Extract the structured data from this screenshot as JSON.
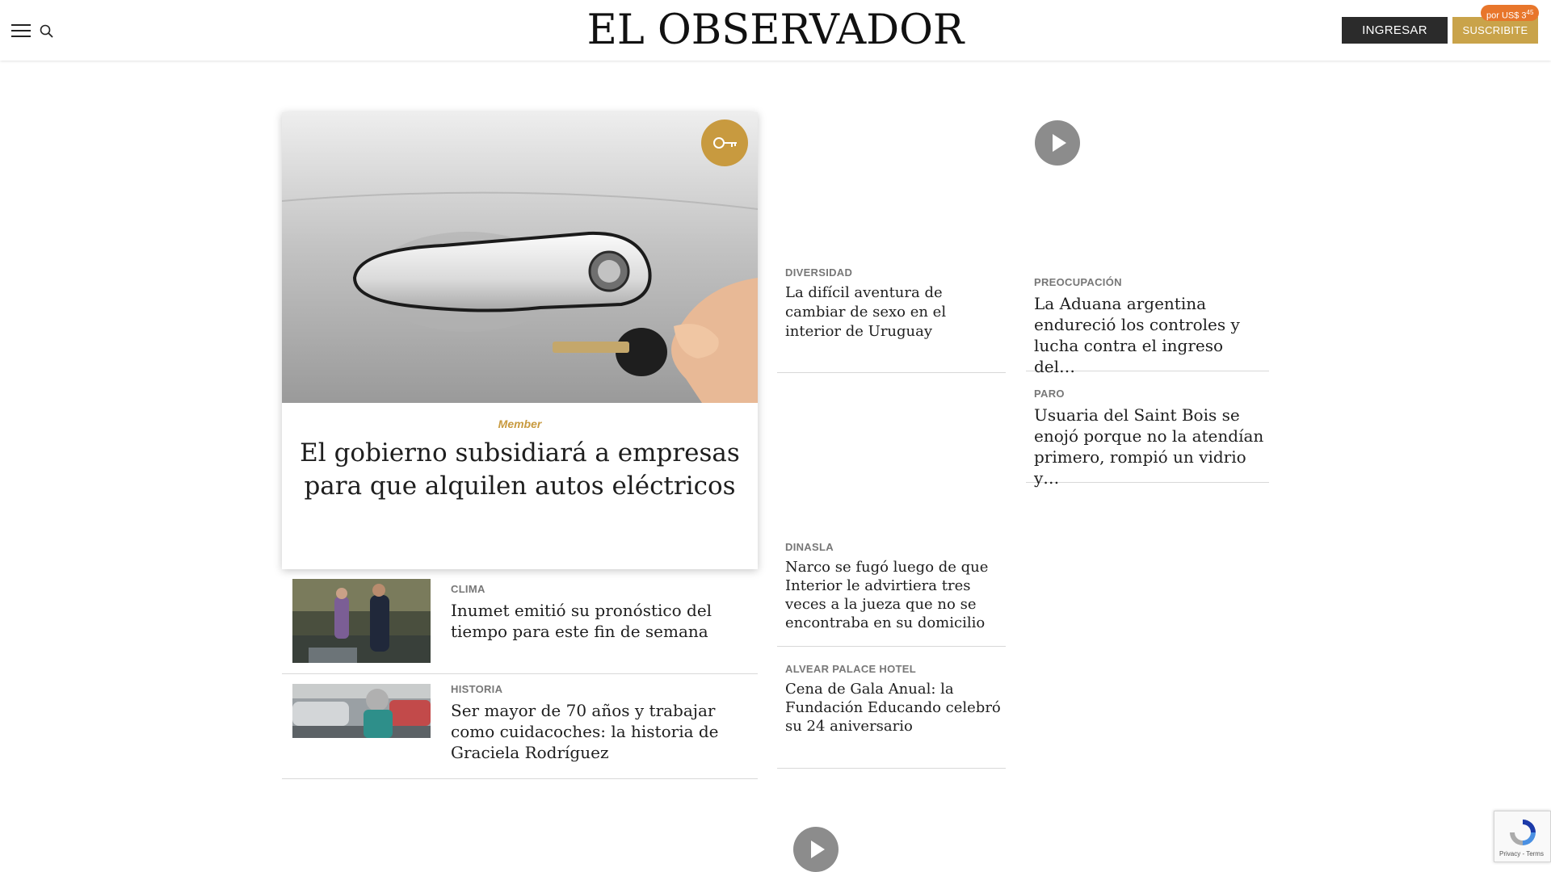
{
  "header": {
    "logo": "EL OBSERVADOR",
    "login_label": "INGRESAR",
    "subscribe_label": "SUSCRIBITE",
    "price_badge": "por US$ 3",
    "price_badge_sup": "45",
    "icons": [
      "menu-icon",
      "search-icon"
    ]
  },
  "featured": {
    "badge_icon": "key-icon",
    "member_label": "Member",
    "title": "El gobierno subsidiará a empresas para que alquilen autos eléctricos"
  },
  "small_stories": [
    {
      "category": "CLIMA",
      "title": "Inumet emitió su pronóstico del tiempo para este fin de semana"
    },
    {
      "category": "HISTORIA",
      "title": "Ser mayor de 70 años y trabajar como cuidacoches: la historia de Graciela Rodríguez"
    }
  ],
  "middle_column": [
    {
      "category": "DIVERSIDAD",
      "title": "La difícil aventura de cambiar de sexo en el interior de Uruguay"
    },
    {
      "category": "DINASLA",
      "title": "Narco se fugó luego de que Interior le advirtiera tres veces a la jueza que no se encontraba en su domicilio"
    },
    {
      "category": "ALVEAR PALACE HOTEL",
      "title": "Cena de Gala Anual: la Fundación Educando celebró su 24 aniversario"
    }
  ],
  "right_column": [
    {
      "category": "PREOCUPACIÓN",
      "title": "La Aduana argentina endureció los controles y lucha contra el ingreso del…"
    },
    {
      "category": "PARO",
      "title": "Usuaria del Saint Bois se enojó porque no la atendían primero, rompió un vidrio y…"
    }
  ],
  "recaptcha": {
    "text": "Privacy - Terms"
  },
  "colors": {
    "accent_gold": "#c89a3f",
    "subscribe": "#c9a34a",
    "badge_orange": "#e8762b",
    "login_bg": "#2b2b2b"
  }
}
